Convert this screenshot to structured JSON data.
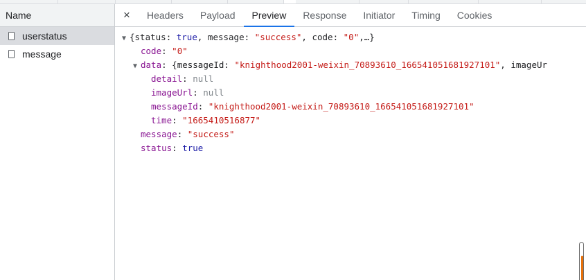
{
  "left": {
    "header": "Name",
    "requests": [
      {
        "name": "userstatus",
        "selected": true
      },
      {
        "name": "message",
        "selected": false
      }
    ]
  },
  "tabs": {
    "close": "×",
    "items": [
      "Headers",
      "Payload",
      "Preview",
      "Response",
      "Initiator",
      "Timing",
      "Cookies"
    ],
    "active": "Preview"
  },
  "preview": {
    "summary": {
      "open": "{",
      "status_key": "status",
      "status_val": "true",
      "message_key": "message",
      "message_val": "\"success\"",
      "code_key": "code",
      "code_val": "\"0\"",
      "tail": ",…}"
    },
    "code": {
      "key": "code",
      "value": "\"0\""
    },
    "data": {
      "key": "data",
      "summary_open": "{messageId: ",
      "summary_value": "\"knighthood2001-weixin_70893610_166541051681927101\"",
      "summary_tail": ", imageUr",
      "detail_key": "detail",
      "detail_val": "null",
      "imageUrl_key": "imageUrl",
      "imageUrl_val": "null",
      "messageId_key": "messageId",
      "messageId_val": "\"knighthood2001-weixin_70893610_166541051681927101\"",
      "time_key": "time",
      "time_val": "\"1665410516877\""
    },
    "message": {
      "key": "message",
      "value": "\"success\""
    },
    "status": {
      "key": "status",
      "value": "true"
    }
  },
  "colors": {
    "key": "#881391",
    "string": "#c41a16",
    "boolean": "#1a1aa6",
    "null": "#80868b",
    "active_tab_underline": "#1a73e8",
    "scroll_accent": "#e8710a"
  }
}
